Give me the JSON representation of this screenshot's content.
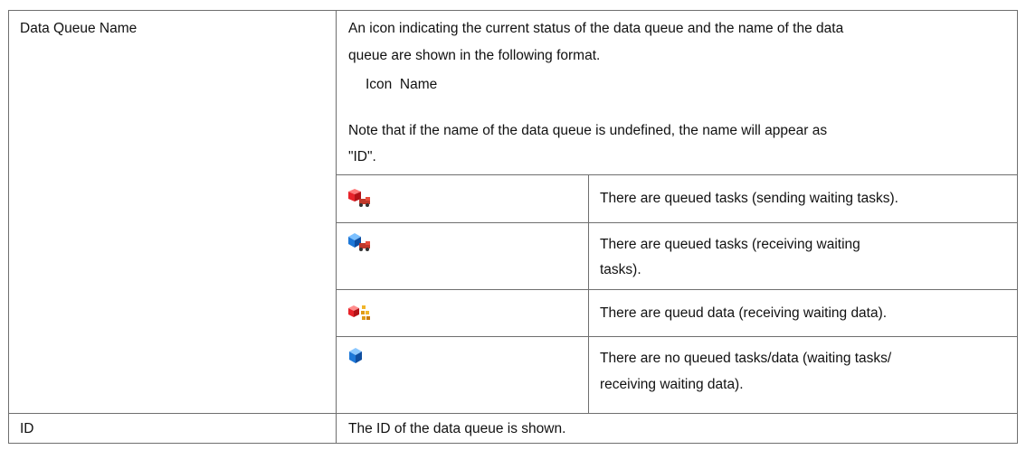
{
  "rows": {
    "data_queue_name": {
      "label": "Data Queue Name",
      "description_line1": "An icon indicating the current status of the data queue and the name of the data",
      "description_line2": "queue are shown in the following format.",
      "format_line": "Icon  Name",
      "note_line1": "Note that if the name of the data queue is undefined, the name will appear as",
      "note_line2": "\"ID\".",
      "icon_states": [
        {
          "icon": "red-block-with-truck-icon",
          "text_line1": "There are queued tasks (sending waiting tasks).",
          "text_line2": ""
        },
        {
          "icon": "blue-block-with-truck-icon",
          "text_line1": "There are queued tasks (receiving waiting",
          "text_line2": "tasks)."
        },
        {
          "icon": "red-block-with-data-icon",
          "text_line1": "There are queud data (receiving waiting data).",
          "text_line2": ""
        },
        {
          "icon": "blue-block-icon",
          "text_line1": "There are no queued tasks/data (waiting tasks/",
          "text_line2": "receiving waiting data)."
        }
      ]
    },
    "id": {
      "label": "ID",
      "description": "The ID of the data queue is shown."
    }
  },
  "colors": {
    "border": "#6f6f6f",
    "red": "#e8232a",
    "blue": "#1e78d8",
    "truck": "#7a2a1c",
    "data_orange": "#e09a18"
  }
}
